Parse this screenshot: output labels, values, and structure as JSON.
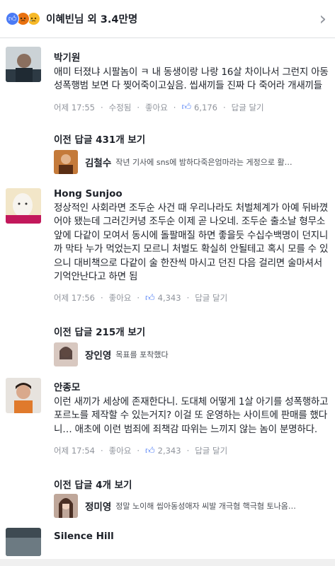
{
  "header": {
    "title": "이혜빈님 외 3.4만명",
    "reactions": [
      "like-icon",
      "angry-icon",
      "sad-icon"
    ]
  },
  "comments": [
    {
      "author": "박기원",
      "text": "애미 터졌냐 시팔놈이 ㅋ 내 동생이랑 나랑 16살 차이나서 그런지 아동성폭행범 보면 다 찢어죽이고싶음. 씹새끼들 진짜 다 죽어라 개새끼들",
      "time": "어제 17:55",
      "edit": "수정됨",
      "like": "좋아요",
      "count": "6,176",
      "reply": "답글 달기",
      "prev_replies": "이전 답글 431개 보기",
      "reply_author": "김철수",
      "reply_text": "작년 기사에 sns에 밤하다죽은엄마라는 게정으로 활…"
    },
    {
      "author": "Hong Sunjoo",
      "text": "정상적인 사회라면 조두순 사건 때 우리나라도 처벌체계가 아예 뒤바꼈어야 됐는데 그러긴커녕 조두순 이제 곧 나오네. 조두순 출소날 형무소 앞에 다같이 모여서 동시에 돌팔매질 하면 좋을듯 수십수백명이 던지니까 막타 누가 먹었는지 모르니 처벌도 확실히 안될테고 혹시 모를 수 있으니 대비책으로 다같이 술 한잔씩 마시고 던진 다음 걸리면 술마셔서 기억안난다고 하면 됨",
      "time": "어제 17:56",
      "like": "좋아요",
      "count": "4,343",
      "reply": "답글 달기",
      "prev_replies": "이전 답글 215개 보기",
      "reply_author": "장인영",
      "reply_text": "목표를 포착했다"
    },
    {
      "author": "안종모",
      "text": "이런 새끼가 세상에 존재한다니. 도대체 어떻게 1살 아기를 성폭행하고 포르노를 제작할 수 있는거지? 이걸 또 운영하는 사이트에 판매를 했다니… 애초에 이런 범죄에 죄책감 따위는 느끼지 않는 놈이 분명하다.",
      "time": "어제 17:54",
      "like": "좋아요",
      "count": "2,343",
      "reply": "답글 달기",
      "prev_replies": "이전 답글 4개 보기",
      "reply_author": "정미영",
      "reply_text": "정말 노이해 씹아동성애자 씨발 개극혐 핵극혐 토나옴…"
    },
    {
      "author": "Silence Hill"
    }
  ],
  "colors": {
    "accent": "#4b7bf5",
    "meta": "#90949c",
    "text": "#1d2129"
  }
}
